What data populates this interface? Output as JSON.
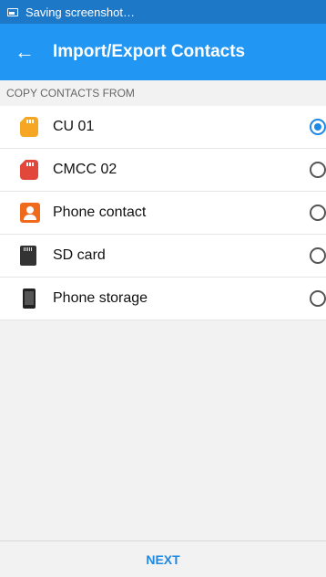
{
  "statusbar": {
    "text": "Saving screenshot…",
    "icon": "screenshot-icon"
  },
  "appbar": {
    "title": "Import/Export Contacts",
    "back_icon": "arrow-left-icon"
  },
  "section": {
    "header": "COPY CONTACTS FROM"
  },
  "sources": [
    {
      "label": "CU 01",
      "icon": "sim-card-orange-icon",
      "selected": true
    },
    {
      "label": "CMCC 02",
      "icon": "sim-card-red-icon",
      "selected": false
    },
    {
      "label": "Phone contact",
      "icon": "phone-contact-icon",
      "selected": false
    },
    {
      "label": "SD card",
      "icon": "sd-card-icon",
      "selected": false
    },
    {
      "label": "Phone storage",
      "icon": "phone-storage-icon",
      "selected": false
    }
  ],
  "footer": {
    "next_label": "NEXT"
  },
  "colors": {
    "accent": "#2196f3",
    "statusbar": "#1e78c8",
    "radio_selected": "#1e88e5"
  }
}
